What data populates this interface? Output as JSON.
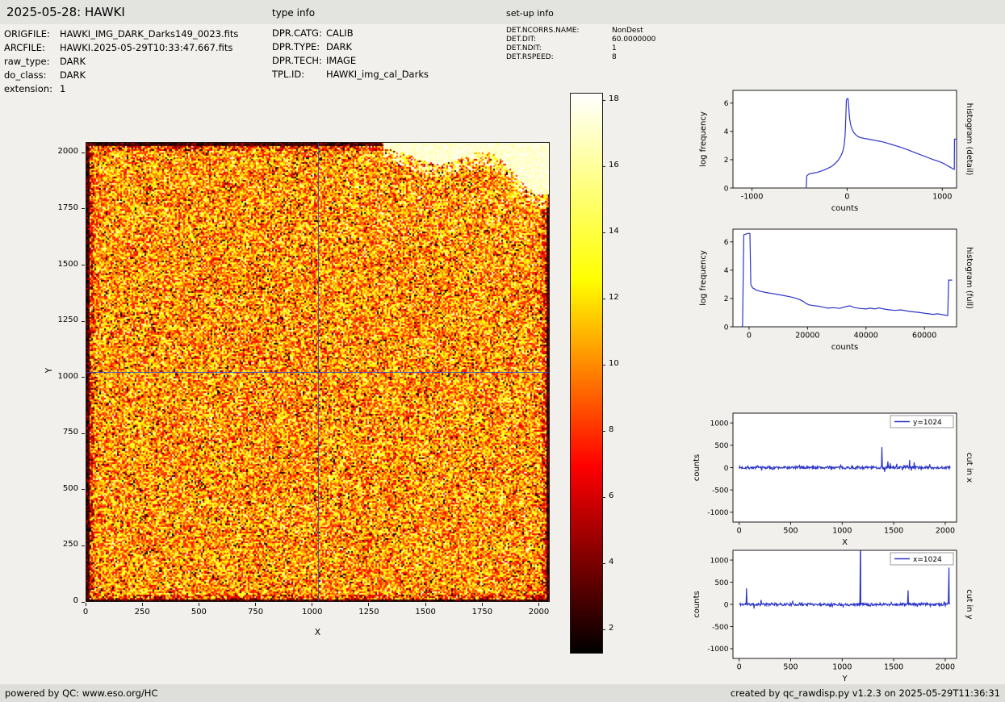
{
  "header": {
    "title": "2025-05-28: HAWKI",
    "section_type_info": "type info",
    "section_setup_info": "set-up info"
  },
  "meta_left": [
    {
      "label": "ORIGFILE:",
      "value": "HAWKI_IMG_DARK_Darks149_0023.fits"
    },
    {
      "label": "ARCFILE:",
      "value": "HAWKI.2025-05-29T10:33:47.667.fits"
    },
    {
      "label": "raw_type:",
      "value": "DARK"
    },
    {
      "label": "do_class:",
      "value": "DARK"
    },
    {
      "label": "extension:",
      "value": "1"
    }
  ],
  "meta_type": [
    {
      "label": "DPR.CATG:",
      "value": "CALIB"
    },
    {
      "label": "DPR.TYPE:",
      "value": "DARK"
    },
    {
      "label": "DPR.TECH:",
      "value": "IMAGE"
    },
    {
      "label": "TPL.ID:",
      "value": "HAWKI_img_cal_Darks"
    }
  ],
  "meta_setup": [
    {
      "label": "DET.NCORRS.NAME:",
      "value": "NonDest"
    },
    {
      "label": "DET.DIT:",
      "value": "60.0000000"
    },
    {
      "label": "DET.NDIT:",
      "value": "1"
    },
    {
      "label": "DET.RSPEED:",
      "value": "8"
    }
  ],
  "footer": {
    "left": "powered by QC: www.eso.org/HC",
    "right": "created by qc_rawdisp.py v1.2.3 on 2025-05-29T11:36:31"
  },
  "chart_data": [
    {
      "type": "heatmap",
      "id": "dark-frame-image",
      "title": "",
      "xlabel": "X",
      "ylabel": "Y",
      "xlim": [
        0,
        2048
      ],
      "ylim": [
        0,
        2048
      ],
      "xticks": [
        0,
        250,
        500,
        750,
        1000,
        1250,
        1500,
        1750,
        2000
      ],
      "yticks": [
        0,
        250,
        500,
        750,
        1000,
        1250,
        1500,
        1750,
        2000
      ],
      "colormap": "hot",
      "vmin": 1.3,
      "vmax": 18.2,
      "colorbar_ticks": [
        18,
        16,
        14,
        12,
        10,
        8,
        6,
        4,
        2
      ],
      "crosshair": {
        "x": 1024,
        "y": 1024
      },
      "seed": 42,
      "description": "2048x2048 raw dark frame: orange/red speckle noise, dark frame edges, saturated white blob region in top-right corner, blue crosshair cuts at x=1024 and y=1024"
    },
    {
      "type": "line",
      "id": "hist-detail",
      "xlabel": "counts",
      "ylabel": "log frequency",
      "right_label": "histogram (detail)",
      "xlim": [
        -1200,
        1150
      ],
      "ylim": [
        0,
        6.9
      ],
      "xticks": [
        -1000,
        0,
        1000
      ],
      "yticks": [
        0,
        2,
        4,
        6
      ],
      "line_color": "#2b35c8",
      "points": [
        [
          -430,
          0
        ],
        [
          -425,
          0.85
        ],
        [
          -400,
          1.0
        ],
        [
          -360,
          1.05
        ],
        [
          -320,
          1.1
        ],
        [
          -280,
          1.18
        ],
        [
          -240,
          1.28
        ],
        [
          -200,
          1.4
        ],
        [
          -170,
          1.5
        ],
        [
          -145,
          1.62
        ],
        [
          -120,
          1.78
        ],
        [
          -100,
          1.92
        ],
        [
          -80,
          2.1
        ],
        [
          -60,
          2.35
        ],
        [
          -45,
          2.6
        ],
        [
          -32,
          3.0
        ],
        [
          -22,
          3.7
        ],
        [
          -14,
          5.0
        ],
        [
          -8,
          6.2
        ],
        [
          0,
          6.32
        ],
        [
          10,
          6.3
        ],
        [
          18,
          5.6
        ],
        [
          26,
          4.9
        ],
        [
          38,
          4.45
        ],
        [
          52,
          4.15
        ],
        [
          70,
          3.92
        ],
        [
          92,
          3.75
        ],
        [
          115,
          3.63
        ],
        [
          145,
          3.55
        ],
        [
          185,
          3.5
        ],
        [
          225,
          3.45
        ],
        [
          265,
          3.4
        ],
        [
          305,
          3.35
        ],
        [
          345,
          3.3
        ],
        [
          385,
          3.24
        ],
        [
          425,
          3.16
        ],
        [
          465,
          3.08
        ],
        [
          505,
          3.0
        ],
        [
          545,
          2.92
        ],
        [
          585,
          2.83
        ],
        [
          625,
          2.73
        ],
        [
          665,
          2.63
        ],
        [
          705,
          2.52
        ],
        [
          745,
          2.42
        ],
        [
          785,
          2.31
        ],
        [
          825,
          2.21
        ],
        [
          865,
          2.11
        ],
        [
          905,
          2.01
        ],
        [
          945,
          1.92
        ],
        [
          985,
          1.82
        ],
        [
          1015,
          1.73
        ],
        [
          1045,
          1.62
        ],
        [
          1070,
          1.52
        ],
        [
          1090,
          1.44
        ],
        [
          1105,
          1.38
        ],
        [
          1118,
          1.33
        ],
        [
          1126,
          1.32
        ],
        [
          1128,
          3.45
        ],
        [
          1148,
          3.45
        ]
      ]
    },
    {
      "type": "line",
      "id": "hist-full",
      "xlabel": "counts",
      "ylabel": "log frequency",
      "right_label": "histogram (full)",
      "xlim": [
        -5500,
        71000
      ],
      "ylim": [
        0,
        6.9
      ],
      "xticks": [
        0,
        20000,
        40000,
        60000
      ],
      "yticks": [
        0,
        2,
        4,
        6
      ],
      "line_color": "#2b35c8",
      "points": [
        [
          -2500,
          0
        ],
        [
          -2200,
          0.1
        ],
        [
          -1800,
          6.5
        ],
        [
          -500,
          6.6
        ],
        [
          300,
          6.6
        ],
        [
          600,
          3.0
        ],
        [
          1200,
          2.75
        ],
        [
          2500,
          2.6
        ],
        [
          4000,
          2.5
        ],
        [
          6000,
          2.42
        ],
        [
          8000,
          2.35
        ],
        [
          10000,
          2.28
        ],
        [
          12000,
          2.2
        ],
        [
          14000,
          2.12
        ],
        [
          15500,
          2.05
        ],
        [
          17000,
          1.95
        ],
        [
          18500,
          1.8
        ],
        [
          19500,
          1.65
        ],
        [
          20500,
          1.55
        ],
        [
          22000,
          1.5
        ],
        [
          24000,
          1.45
        ],
        [
          25500,
          1.38
        ],
        [
          27000,
          1.32
        ],
        [
          29000,
          1.35
        ],
        [
          31000,
          1.3
        ],
        [
          33000,
          1.42
        ],
        [
          34500,
          1.48
        ],
        [
          36000,
          1.36
        ],
        [
          38000,
          1.3
        ],
        [
          40000,
          1.26
        ],
        [
          41500,
          1.32
        ],
        [
          43000,
          1.26
        ],
        [
          44500,
          1.34
        ],
        [
          46000,
          1.26
        ],
        [
          48000,
          1.2
        ],
        [
          50000,
          1.16
        ],
        [
          52000,
          1.2
        ],
        [
          54000,
          1.12
        ],
        [
          56000,
          1.06
        ],
        [
          58000,
          1.02
        ],
        [
          60000,
          0.96
        ],
        [
          61500,
          0.92
        ],
        [
          63000,
          0.88
        ],
        [
          64500,
          0.92
        ],
        [
          66000,
          0.86
        ],
        [
          67200,
          0.82
        ],
        [
          68000,
          0.8
        ],
        [
          68300,
          3.3
        ],
        [
          69500,
          3.3
        ]
      ]
    },
    {
      "type": "line",
      "id": "cut-x",
      "mode": "noise",
      "legend": "y=1024",
      "xlabel": "X",
      "ylabel": "counts",
      "right_label": "cut in x",
      "xlim": [
        -60,
        2110
      ],
      "ylim": [
        -1220,
        1220
      ],
      "xticks": [
        0,
        500,
        1000,
        1500,
        2000
      ],
      "yticks": [
        -1000,
        -500,
        0,
        500,
        1000
      ],
      "line_color": "#2b35c8",
      "seed": 7,
      "n_points": 430,
      "data_x_range": [
        0,
        2048
      ],
      "noise_amplitude": 30,
      "spikes": [
        [
          1385,
          460
        ],
        [
          1412,
          -95
        ],
        [
          1443,
          140
        ],
        [
          1468,
          95
        ],
        [
          1530,
          85
        ],
        [
          1600,
          60
        ],
        [
          1655,
          170
        ],
        [
          1698,
          120
        ],
        [
          1850,
          75
        ]
      ]
    },
    {
      "type": "line",
      "id": "cut-y",
      "mode": "noise",
      "legend": "x=1024",
      "xlabel": "Y",
      "ylabel": "counts",
      "right_label": "cut in y",
      "xlim": [
        -60,
        2110
      ],
      "ylim": [
        -1220,
        1220
      ],
      "xticks": [
        0,
        500,
        1000,
        1500,
        2000
      ],
      "yticks": [
        -1000,
        -500,
        0,
        500,
        1000
      ],
      "line_color": "#2b35c8",
      "seed": 11,
      "n_points": 430,
      "data_x_range": [
        0,
        2048
      ],
      "noise_amplitude": 30,
      "spikes": [
        [
          72,
          360
        ],
        [
          145,
          -95
        ],
        [
          212,
          100
        ],
        [
          520,
          65
        ],
        [
          1178,
          1600
        ],
        [
          1640,
          315
        ],
        [
          2036,
          830
        ]
      ]
    }
  ]
}
